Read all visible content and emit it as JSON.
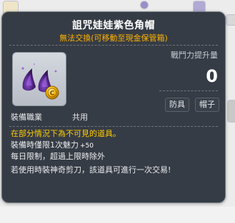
{
  "item": {
    "name": "詛咒娃娃紫色角帽",
    "untradeable": "無法交換(可移動至現金保管箱)",
    "icon": "purple-horned-hat-icon",
    "coin_icon": "coin-icon"
  },
  "combat_power": {
    "label": "戰鬥力提升量",
    "value": "0"
  },
  "tags": [
    "防具",
    "帽子"
  ],
  "job": {
    "label": "裝備職業",
    "value": "共用"
  },
  "description": {
    "line1": "在部分情況下為不可見的道具。",
    "line2_text": "裝備時僅限1次魅力",
    "line2_bonus": "+50",
    "line3": "每日限制，超過上限時除外",
    "line4": "若使用時裝神奇剪刀，該道具可進行一次交易!"
  },
  "colors": {
    "panel": "#2b313a",
    "title": "#ffffff",
    "untradeable": "#ffb300",
    "highlight": "#ffcc00",
    "hat": "#5b2a8a"
  }
}
